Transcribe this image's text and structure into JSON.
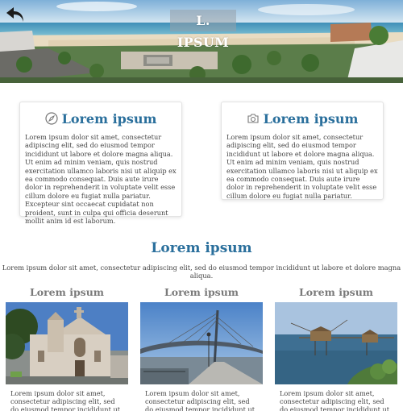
{
  "hero": {
    "title": "L. IPSUM",
    "back_icon": "undo-arrow-icon"
  },
  "cards": [
    {
      "icon": "compass-icon",
      "title": "Lorem ipsum",
      "text": "Lorem ipsum dolor sit amet, consectetur adipiscing elit, sed do eiusmod tempor incididunt ut labore et dolore magna aliqua. Ut enim ad minim veniam, quis nostrud exercitation ullamco laboris nisi ut aliquip ex ea commodo consequat. Duis aute irure dolor in reprehenderit in voluptate velit esse cillum dolore eu fugiat nulla pariatur. Excepteur sint occaecat cupidatat non proident, sunt in culpa qui officia deserunt mollit anim id est laborum."
    },
    {
      "icon": "camera-icon",
      "title": "Lorem ipsum",
      "text": "Lorem ipsum dolor sit amet, consectetur adipiscing elit, sed do eiusmod tempor incididunt ut labore et dolore magna aliqua. Ut enim ad minim veniam, quis nostrud exercitation ullamco laboris nisi ut aliquip ex ea commodo consequat. Duis aute irure dolor in reprehenderit in voluptate velit esse cillum dolore eu fugiat nulla pariatur."
    }
  ],
  "section": {
    "title": "Lorem ipsum",
    "text": "Lorem ipsum dolor sit amet, consectetur adipiscing elit, sed do eiusmod tempor incididunt ut labore et dolore magna aliqua."
  },
  "gallery": [
    {
      "title": "Lorem ipsum",
      "text": "Lorem ipsum dolor sit amet, consectetur adipiscing elit, sed do eiusmod tempor incididunt ut"
    },
    {
      "title": "Lorem ipsum",
      "text": "Lorem ipsum dolor sit amet, consectetur adipiscing elit, sed do eiusmod tempor incididunt ut"
    },
    {
      "title": "Lorem ipsum",
      "text": "Lorem ipsum dolor sit amet, consectetur adipiscing elit, sed do eiusmod tempor incididunt ut"
    }
  ],
  "colors": {
    "accent": "#2a6f9c",
    "subtitle": "#7a7a7a",
    "text": "#444444"
  }
}
